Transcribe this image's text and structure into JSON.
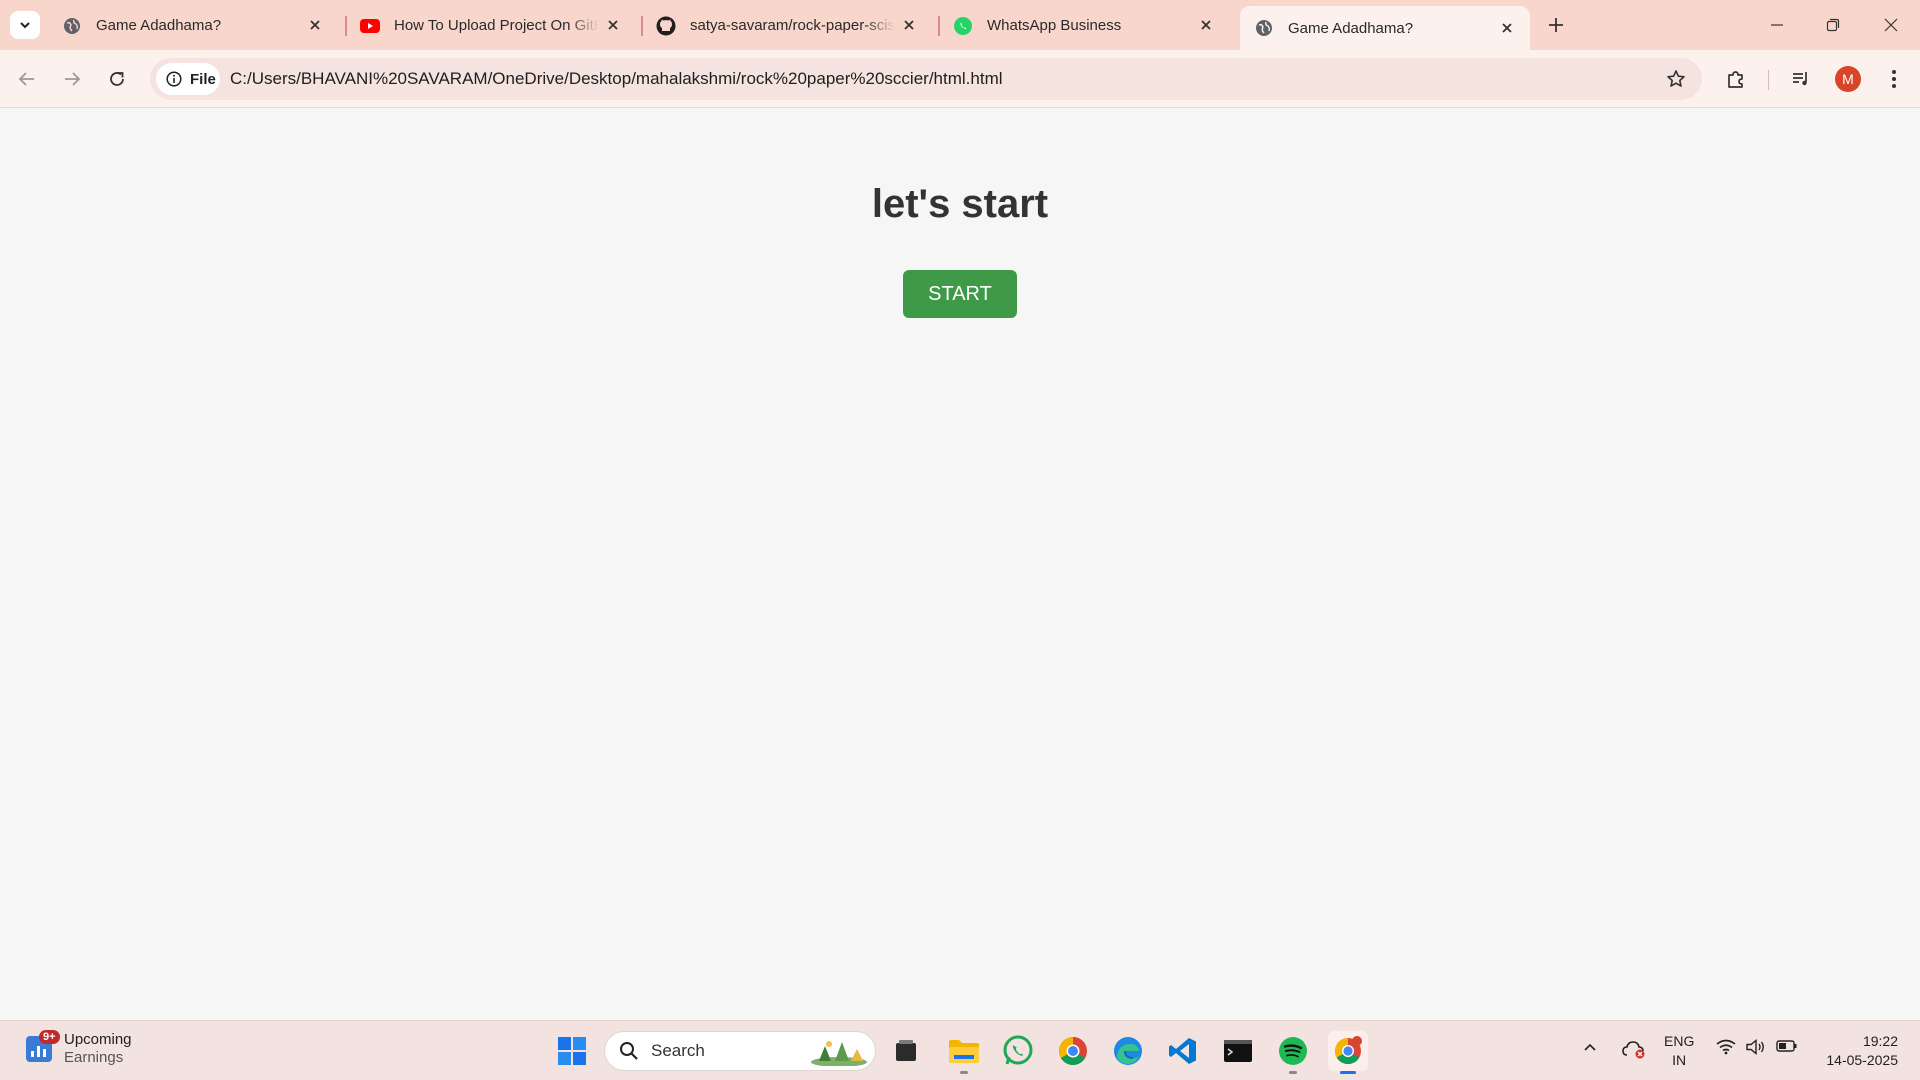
{
  "browser": {
    "tabs": [
      {
        "title": "Game Adadhama?",
        "favicon": "globe-icon",
        "active": false
      },
      {
        "title": "How To Upload Project On GitHub",
        "favicon": "youtube-icon",
        "active": false
      },
      {
        "title": "satya-savaram/rock-paper-scissors",
        "favicon": "github-icon",
        "active": false
      },
      {
        "title": "WhatsApp Business",
        "favicon": "whatsapp-icon",
        "active": false
      },
      {
        "title": "Game Adadhama?",
        "favicon": "globe-icon",
        "active": true
      }
    ],
    "site_chip_label": "File",
    "url": "C:/Users/BHAVANI%20SAVARAM/OneDrive/Desktop/mahalakshmi/rock%20paper%20sccier/html.html",
    "profile_initial": "M"
  },
  "page": {
    "heading": "let's start",
    "start_button": "START",
    "button_color": "#3f9a47"
  },
  "taskbar": {
    "widget": {
      "badge": "9+",
      "line1": "Upcoming",
      "line2": "Earnings"
    },
    "search_placeholder": "Search",
    "apps": [
      "start-icon",
      "task-view-icon",
      "file-explorer-icon",
      "whatsapp-icon",
      "chrome-icon",
      "edge-icon",
      "vscode-icon",
      "terminal-icon",
      "spotify-icon",
      "chrome-profile-icon"
    ],
    "lang_line1": "ENG",
    "lang_line2": "IN",
    "time": "19:22",
    "date": "14-05-2025"
  }
}
